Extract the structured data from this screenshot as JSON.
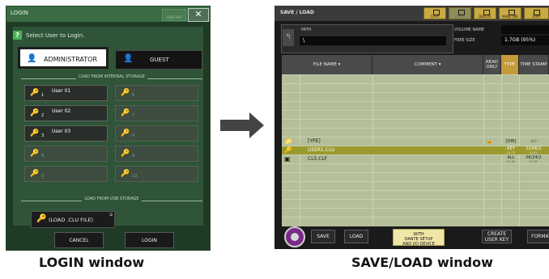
{
  "login": {
    "title": "LOGIN",
    "user_key_top": "USER KEY",
    "close": "✕",
    "prompt": "Select User to Login.",
    "admin_label": "ADMINISTRATOR",
    "guest_label": "GUEST",
    "internal_section": "LOAD FROM INTERNAL STORAGE",
    "slots": [
      {
        "num": "1",
        "name": "User 01"
      },
      {
        "num": "6",
        "name": ""
      },
      {
        "num": "2",
        "name": "User 02"
      },
      {
        "num": "7",
        "name": ""
      },
      {
        "num": "3",
        "name": "User 03"
      },
      {
        "num": "8",
        "name": ""
      },
      {
        "num": "4",
        "name": ""
      },
      {
        "num": "9",
        "name": ""
      },
      {
        "num": "5",
        "name": ""
      },
      {
        "num": "10",
        "name": ""
      }
    ],
    "usb_section": "LOAD FROM USB STORAGE",
    "usb_button": "(LOAD .CLU FILE)",
    "cancel": "CANCEL",
    "login_btn": "LOGIN"
  },
  "save": {
    "title": "SAVE / LOAD",
    "toolbar": [
      "COPY",
      "PASTE",
      "DELETE",
      "MAKE DIR",
      "SORT"
    ],
    "path_label": "PATH",
    "path_value": "\\",
    "volume_label": "VOLUME NAME",
    "free_label": "FREE SIZE",
    "free_value": "1.7GB (95%)",
    "columns": [
      "FILE NAME",
      "COMMENT",
      "READ ONLY",
      "TYPE",
      "TIME STAMP"
    ],
    "files": [
      {
        "name": "[YPE]",
        "icon": "folder-icon",
        "readonly": "🔒",
        "type": "[DIR]",
        "stamp": "-/-/-"
      },
      {
        "name": "USER1.CLU",
        "icon": "user-key-file-icon",
        "readonly": "",
        "type": "KEY",
        "type_ver": "V1.70",
        "stamp": "12/06/2",
        "stamp_time": "10:05:"
      },
      {
        "name": "CL5.CLF",
        "icon": "cl-file-icon",
        "readonly": "",
        "type": "ALL",
        "type_ver": "V1.50",
        "stamp": "06/24/2",
        "stamp_time": "17:15:"
      }
    ],
    "bottom": {
      "save": "SAVE",
      "load": "LOAD",
      "dante_1": "WITH",
      "dante_2": "DANTE SETUP",
      "dante_3": "AND I/O DEVICE",
      "create_1": "CREATE",
      "create_2": "USER KEY",
      "format": "FORMAT"
    }
  },
  "captions": {
    "login": "LOGIN window",
    "save": "SAVE/LOAD window"
  }
}
